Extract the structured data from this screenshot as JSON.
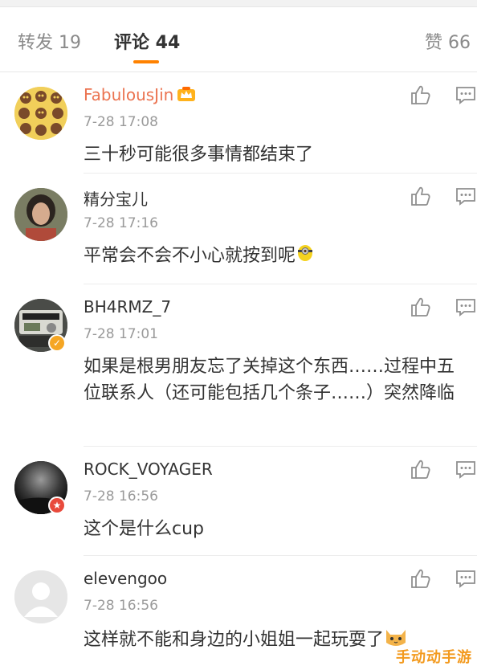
{
  "tabs": {
    "repost": "转发 19",
    "comments": "评论 44",
    "likes": "赞 66"
  },
  "comments": [
    {
      "user": "FabulousJin",
      "time": "7-28 17:08",
      "text": "三十秒可能很多事情都结束了"
    },
    {
      "user": "精分宝儿",
      "time": "7-28 17:16",
      "text": "平常会不会不小心就按到呢"
    },
    {
      "user": "BH4RMZ_7",
      "time": "7-28 17:01",
      "text": "如果是根男朋友忘了关掉这个东西……过程中五位联系人（还可能包括几个条子……）突然降临"
    },
    {
      "user": "ROCK_VOYAGER",
      "time": "7-28 16:56",
      "text": "这个是什么cup"
    },
    {
      "user": "elevengoo",
      "time": "7-28 16:56",
      "text": "这样就不能和身边的小姐姐一起玩耍了"
    }
  ],
  "watermark": "手动动手游",
  "colors": {
    "accent": "#ff8200",
    "vip_name": "#eb7350",
    "time": "#9a9a9a"
  }
}
